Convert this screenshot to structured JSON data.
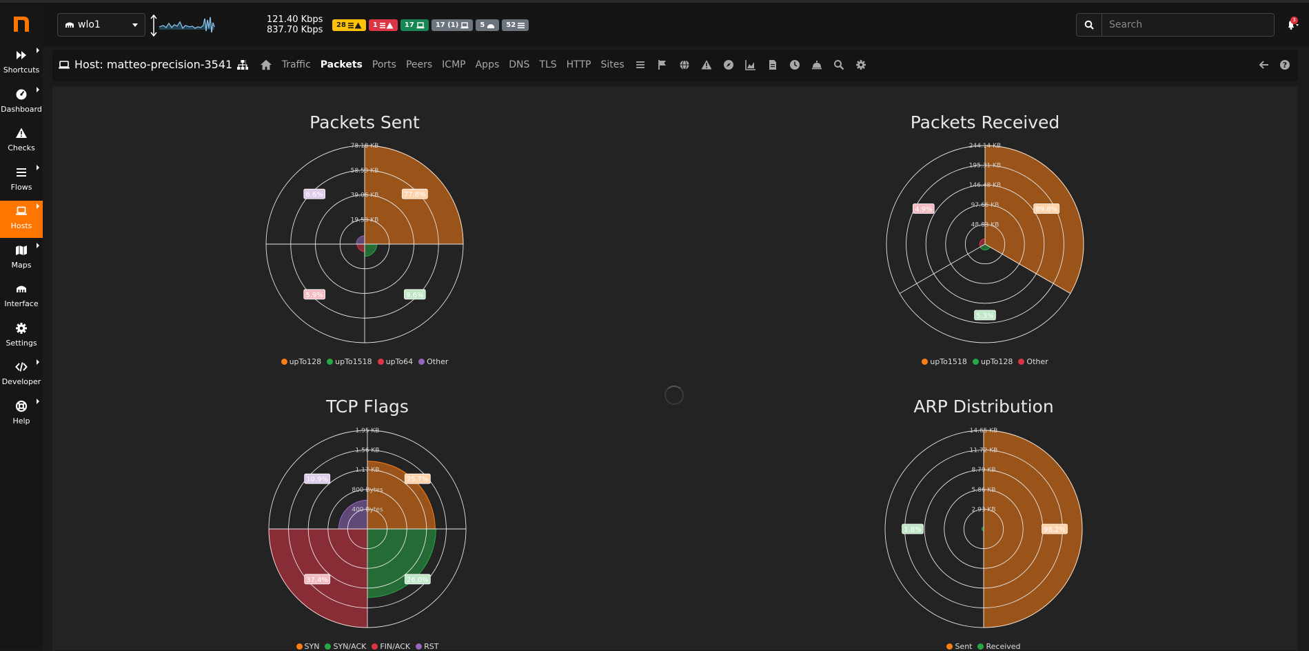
{
  "app": {
    "logo_letter": "n",
    "accent": "#ff7500"
  },
  "sidebar": {
    "items": [
      {
        "label": "Shortcuts",
        "icon": "fast-forward-icon"
      },
      {
        "label": "Dashboard",
        "icon": "gauge-icon"
      },
      {
        "label": "Checks",
        "icon": "warning-icon"
      },
      {
        "label": "Flows",
        "icon": "bars-icon"
      },
      {
        "label": "Hosts",
        "icon": "laptop-icon"
      },
      {
        "label": "Maps",
        "icon": "map-icon"
      },
      {
        "label": "Interface",
        "icon": "ethernet-icon"
      },
      {
        "label": "Settings",
        "icon": "gear-icon"
      },
      {
        "label": "Developer",
        "icon": "code-icon"
      },
      {
        "label": "Help",
        "icon": "lifering-icon"
      }
    ],
    "active": "Hosts"
  },
  "header": {
    "interface": "wlo1",
    "throughput_up": "121.40 Kbps",
    "throughput_down": "837.70 Kbps",
    "badges": [
      {
        "text": "28",
        "color": "#ffc107",
        "text_color": "#1b1b1b",
        "icon": "list-warning-icon"
      },
      {
        "text": "1",
        "color": "#dc3545",
        "text_color": "#ffffff",
        "icon": "list-warning-icon"
      },
      {
        "text": "17",
        "color": "#198754",
        "text_color": "#ffffff",
        "icon": "laptop-icon"
      },
      {
        "text": "17 (1)",
        "color": "#6c757d",
        "text_color": "#ffffff",
        "icon": "laptop-icon"
      },
      {
        "text": "5",
        "color": "#6c757d",
        "text_color": "#ffffff",
        "icon": "cloud-icon"
      },
      {
        "text": "52",
        "color": "#6c757d",
        "text_color": "#ffffff",
        "icon": "list-icon"
      }
    ],
    "search_placeholder": "Search",
    "notifications": "3"
  },
  "hostbar": {
    "title": "Host: matteo-precision-3541",
    "tabs": [
      "Traffic",
      "Packets",
      "Ports",
      "Peers",
      "ICMP",
      "Apps",
      "DNS",
      "TLS",
      "HTTP",
      "Sites"
    ],
    "active_tab": "Packets"
  },
  "chart_data": [
    {
      "type": "pie",
      "title": "Packets Sent",
      "radial_ticks": [
        "78.18 KB",
        "58.59 KB",
        "39.06 KB",
        "19.53 KB"
      ],
      "slices": [
        {
          "name": "upTo128",
          "value": 77.8,
          "label": "77.8%",
          "color": "#fd7e14"
        },
        {
          "name": "upTo1518",
          "value": 9.6,
          "label": "9.6%",
          "color": "#28a745"
        },
        {
          "name": "upTo64",
          "value": 5.9,
          "label": "5.9%",
          "color": "#dc3545"
        },
        {
          "name": "Other",
          "value": 6.6,
          "label": "6.6%",
          "color": "#9467bd"
        }
      ],
      "legend": [
        "upTo128",
        "upTo1518",
        "upTo64",
        "Other"
      ]
    },
    {
      "type": "pie",
      "title": "Packets Received",
      "radial_ticks": [
        "244.14 KB",
        "195.31 KB",
        "146.48 KB",
        "97.66 KB",
        "48.83 KB"
      ],
      "slices": [
        {
          "name": "upTo1518",
          "value": 89.8,
          "label": "89.8%",
          "color": "#fd7e14"
        },
        {
          "name": "upTo128",
          "value": 5.3,
          "label": "5.3%",
          "color": "#28a745"
        },
        {
          "name": "Other",
          "value": 4.9,
          "label": "4.9%",
          "color": "#dc3545"
        }
      ],
      "legend": [
        "upTo1518",
        "upTo128",
        "Other"
      ]
    },
    {
      "type": "pie",
      "title": "TCP Flags",
      "radial_ticks": [
        "1.95 KB",
        "1.56 KB",
        "1.17 KB",
        "800 Bytes",
        "400 Bytes"
      ],
      "slices": [
        {
          "name": "SYN",
          "value": 25.7,
          "label": "25.7%",
          "color": "#fd7e14"
        },
        {
          "name": "SYN/ACK",
          "value": 26.0,
          "label": "26.0%",
          "color": "#28a745"
        },
        {
          "name": "FIN/ACK",
          "value": 37.4,
          "label": "37.4%",
          "color": "#dc3545"
        },
        {
          "name": "RST",
          "value": 10.9,
          "label": "10.9%",
          "color": "#9467bd"
        }
      ],
      "legend": [
        "SYN",
        "SYN/ACK",
        "FIN/ACK",
        "RST"
      ]
    },
    {
      "type": "pie",
      "title": "ARP Distribution",
      "radial_ticks": [
        "14.65 KB",
        "11.72 KB",
        "8.79 KB",
        "5.86 KB",
        "2.93 KB"
      ],
      "slices": [
        {
          "name": "Sent",
          "value": 98.2,
          "label": "98.2%",
          "color": "#fd7e14"
        },
        {
          "name": "Received",
          "value": 1.8,
          "label": "1.8%",
          "color": "#28a745"
        }
      ],
      "legend": [
        "Sent",
        "Received"
      ]
    }
  ]
}
